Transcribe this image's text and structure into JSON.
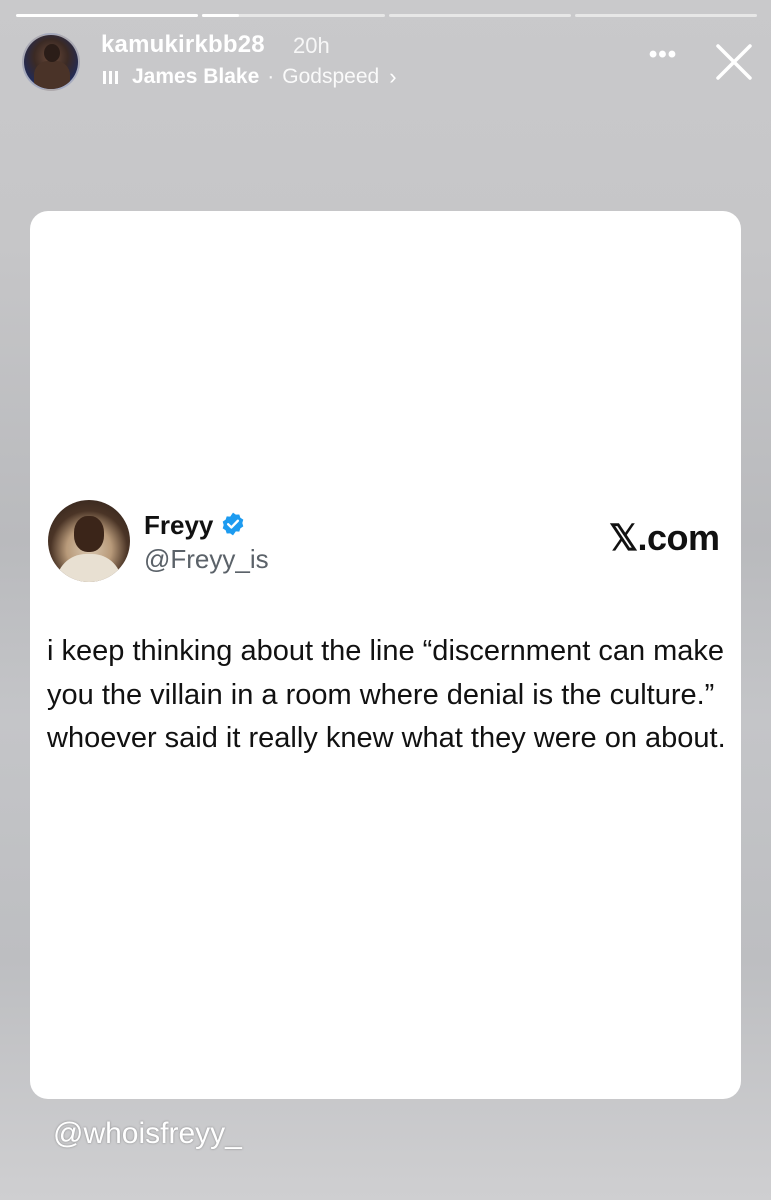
{
  "story": {
    "progress_segments": 4,
    "username": "kamukirkbb28",
    "time_ago": "20h",
    "music": {
      "artist": "James Blake",
      "separator": "·",
      "song": "Godspeed",
      "chevron": "›"
    },
    "more_label": "•••",
    "mention": "@whoisfreyy_"
  },
  "tweet": {
    "display_name": "Freyy",
    "handle": "@Freyy_is",
    "source_label": "𝕏.com",
    "text": "i keep thinking about the line “discernment can make you the villain in a room where denial is the culture.” whoever said it really knew what they were on about.",
    "verified_color": "#1d9bf0"
  }
}
